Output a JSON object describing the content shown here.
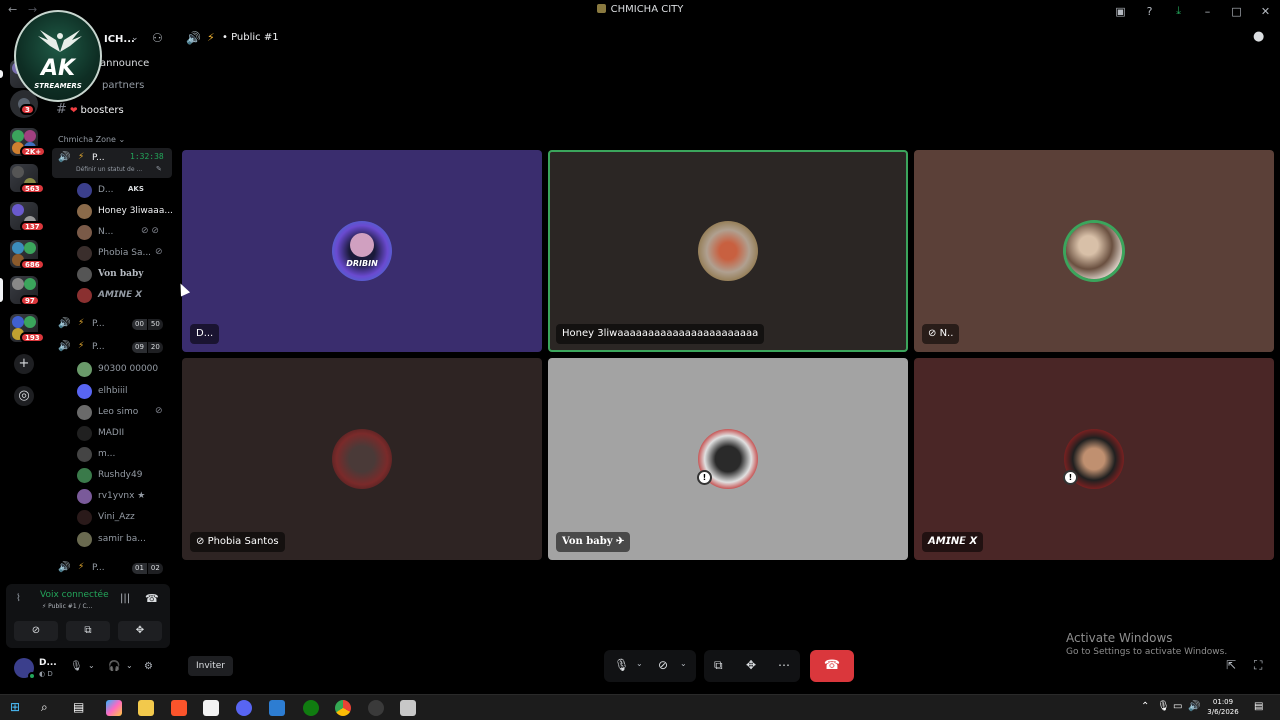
{
  "titlebar": {
    "title": "CHMICHA CITY",
    "back_icon": "arrow-left-icon",
    "forward_icon": "arrow-right-icon",
    "icons": [
      "inbox-icon",
      "help-icon",
      "download-icon",
      "minimize-icon",
      "maximize-icon",
      "close-icon"
    ]
  },
  "logo": {
    "main": "AK",
    "sub": "STREAMERS"
  },
  "rail": {
    "badges": [
      "3",
      "2K+",
      "563",
      "137",
      "686",
      "97",
      "193"
    ],
    "add_server_icon": "plus-icon",
    "discover_icon": "compass-icon"
  },
  "server": {
    "name": "CHMICHA CITY",
    "name_visible": "ICH..."
  },
  "channels": [
    {
      "name": "announce"
    },
    {
      "name": "partners"
    },
    {
      "name": "boosters"
    }
  ],
  "category": "Chmicha Zone",
  "voice_channels": [
    {
      "label": "P...",
      "time": "1:32:38",
      "status_placeholder": "Définir un statut de ..."
    },
    {
      "label": "P...",
      "count": "00",
      "limit": "50"
    },
    {
      "label": "P...",
      "count": "09",
      "limit": "20"
    },
    {
      "label": "P...",
      "count": "01",
      "limit": "02"
    }
  ],
  "voice_users_channel1": [
    {
      "name": "D...",
      "tag": "AKS"
    },
    {
      "name": "Honey 3liwaaa..."
    },
    {
      "name": "N..."
    },
    {
      "name": "Phobia Sa..."
    },
    {
      "name": "Von baby"
    },
    {
      "name": "𝘼𝙈𝙄𝙉𝙀 𝙓"
    }
  ],
  "voice_users_channel3": [
    {
      "name": "90300 00000"
    },
    {
      "name": "elhbiiil"
    },
    {
      "name": "Leo simo"
    },
    {
      "name": "MADII"
    },
    {
      "name": "m..."
    },
    {
      "name": "Rushdy49"
    },
    {
      "name": "rv1yvnx ★"
    },
    {
      "name": "Vini_Azz"
    },
    {
      "name": "samir ba..."
    }
  ],
  "voice_panel": {
    "status": "Voix connectée",
    "sub": "Public #1 / C..."
  },
  "user": {
    "name": "D...",
    "status": "D"
  },
  "call": {
    "channel_title": "Public #1",
    "invite_label": "Inviter"
  },
  "tiles": [
    {
      "name": "D...",
      "bg": "#3a2d6e"
    },
    {
      "name": "Honey 3liwaaaaaaaaaaaaaaaaaaaaaaa",
      "bg": "#2b2624",
      "speaking": true
    },
    {
      "name": "N..",
      "bg": "#5b4038"
    },
    {
      "name": "Phobia Santos",
      "bg": "#2e2423"
    },
    {
      "name": "Von baby",
      "bg": "#a3a3a3"
    },
    {
      "name": "𝘼𝙈𝙄𝙉𝙀 𝙓",
      "bg": "#4a2626"
    }
  ],
  "activate_windows": {
    "line1": "Activate Windows",
    "line2": "Go to Settings to activate Windows."
  },
  "clock": {
    "time": "01:09",
    "date": "3/6/2026"
  }
}
